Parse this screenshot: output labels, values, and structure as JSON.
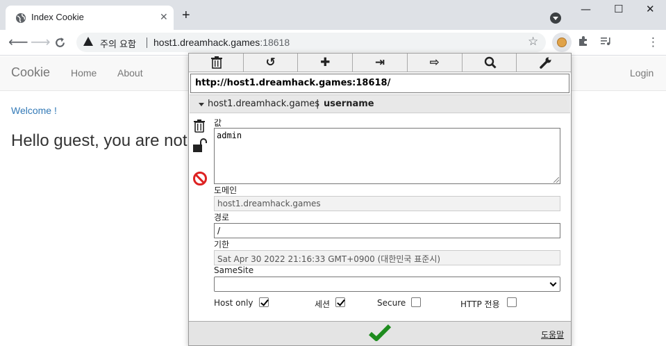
{
  "browser": {
    "tab_title": "Index Cookie",
    "tab_close": "✕",
    "new_tab": "+",
    "security_warning": "주의 요함",
    "url_host": "host1.dreamhack.games",
    "url_port": ":18618",
    "window_minimize": "—",
    "window_maximize": "☐",
    "window_close": "✕"
  },
  "site": {
    "brand": "Cookie",
    "nav": [
      "Home",
      "About"
    ],
    "login": "Login",
    "welcome": "Welcome !",
    "hello": "Hello guest, you are not"
  },
  "cookie_editor": {
    "url": "http://host1.dreamhack.games:18618/",
    "cookie_domain": "host1.dreamhack.games",
    "separator": "|",
    "cookie_name": "username",
    "labels": {
      "value": "값",
      "domain": "도메인",
      "path": "경로",
      "expiry": "기한",
      "samesite": "SameSite",
      "host_only": "Host only",
      "session": "세션",
      "secure": "Secure",
      "http_only": "HTTP 전용",
      "help": "도움말"
    },
    "value": "admin",
    "domain": "host1.dreamhack.games",
    "path": "/",
    "expiry": "Sat Apr 30 2022 21:16:33 GMT+0900 (대한민국 표준시)",
    "samesite": "",
    "host_only": true,
    "session": true,
    "secure": false,
    "http_only": false
  }
}
